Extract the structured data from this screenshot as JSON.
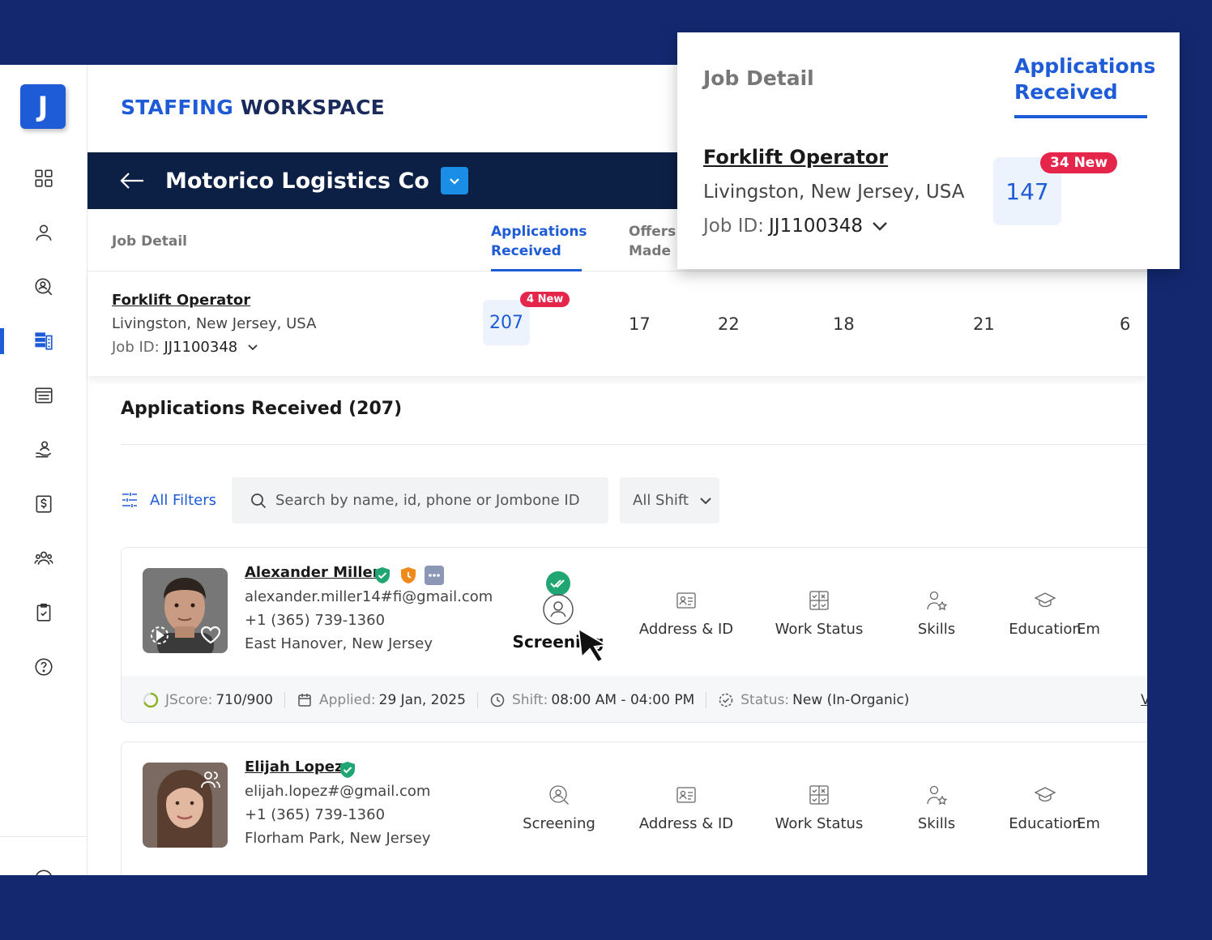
{
  "brand": {
    "part1": "STAFFING",
    "part2": "WORKSPACE"
  },
  "logo_letter": "J",
  "company": {
    "name": "Motorico Logistics Co"
  },
  "columns": {
    "job_detail": "Job Detail",
    "applications": [
      "Applications",
      "Received"
    ],
    "offers": [
      "Offers",
      "Made"
    ]
  },
  "job": {
    "title": "Forklift Operator",
    "location": "Livingston, New Jersey, USA",
    "id_label": "Job ID:",
    "id_value": "JJ1100348",
    "applications_count": "207",
    "new_badge": "4 New",
    "stats": [
      "17",
      "22",
      "18",
      "21",
      "6"
    ]
  },
  "section": {
    "title": "Applications Received (207)"
  },
  "toolbar": {
    "filters_label": "All Filters",
    "search_placeholder": "Search by name, id, phone or Jombone ID",
    "shift_label": "All Shift"
  },
  "steps": [
    "Screening",
    "Address & ID",
    "Work Status",
    "Skills",
    "Education",
    "Em"
  ],
  "candidates": [
    {
      "name": "Alexander Miller",
      "email": "alexander.miller14#fi@gmail.com",
      "phone": "+1 (365) 739-1360",
      "location": "East Hanover, New Jersey",
      "screening_label": "Screening",
      "footer": {
        "jscore_label": "JScore:",
        "jscore_value": "710/900",
        "applied_label": "Applied:",
        "applied_value": "29 Jan, 2025",
        "shift_label": "Shift:",
        "shift_value": "08:00 AM - 04:00 PM",
        "status_label": "Status:",
        "status_value": "New (In-Organic)",
        "more": "V"
      }
    },
    {
      "name": "Elijah Lopez",
      "email": "elijah.lopez#@gmail.com",
      "phone": "+1 (365) 739-1360",
      "location": "Florham Park, New Jersey"
    }
  ],
  "popover": {
    "job_detail": "Job Detail",
    "applications": [
      "Applications",
      "Received"
    ],
    "title": "Forklift Operator",
    "location": "Livingston, New Jersey, USA",
    "id_label": "Job ID:",
    "id_value": "JJ1100348",
    "count": "147",
    "new_badge": "34 New"
  },
  "colors": {
    "accent": "#1e5bd7",
    "navy": "#0c1f45",
    "badge_red": "#e5254a",
    "background": "#13286f"
  }
}
